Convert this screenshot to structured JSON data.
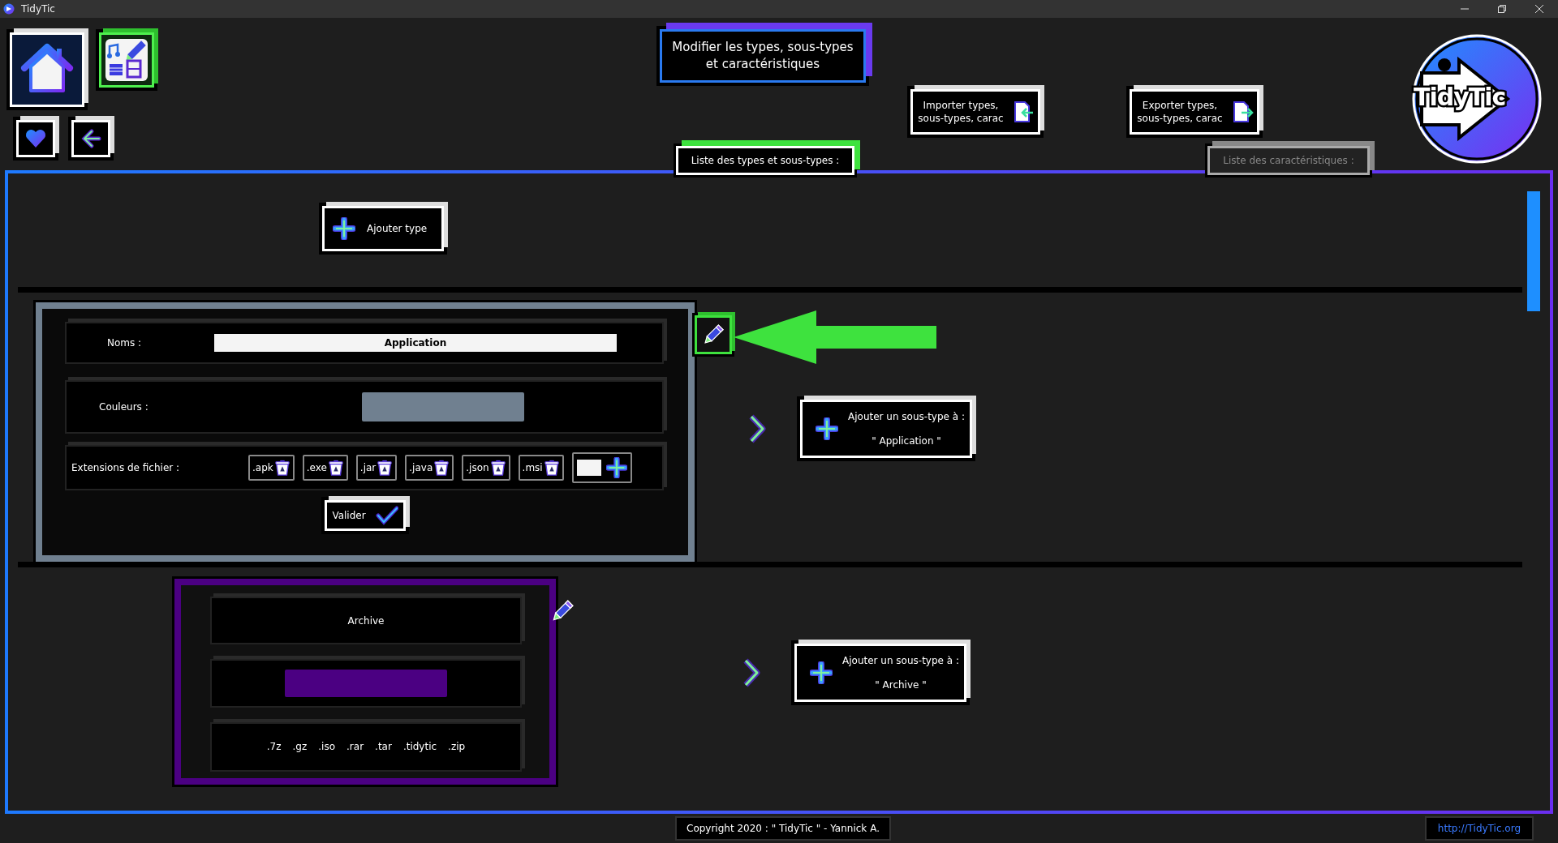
{
  "window": {
    "title": "TidyTic"
  },
  "header": {
    "title": "Modifier les types, sous-types et caractéristiques",
    "import_button": "Importer types, sous-types, carac",
    "export_button": "Exporter types, sous-types, carac",
    "logo_text": "TidyTic"
  },
  "tabs": [
    {
      "label": "Liste des types et sous-types :",
      "selected": true
    },
    {
      "label": "Liste des caractéristiques :",
      "selected": false
    }
  ],
  "add_type_button": "Ajouter type",
  "types": [
    {
      "kind": "editing",
      "name_label": "Noms :",
      "name": "Application",
      "color_label": "Couleurs :",
      "color": "#708090",
      "extensions_label": "Extensions de fichier :",
      "extensions": [
        ".apk",
        ".exe",
        ".jar",
        ".java",
        ".json",
        ".msi"
      ],
      "validate_button": "Valider",
      "add_subtype_label": "Ajouter un sous-type à :",
      "add_subtype_target": "\" Application \""
    },
    {
      "kind": "display",
      "name": "Archive",
      "color": "#4b0082",
      "extensions": [
        ".7z",
        ".gz",
        ".iso",
        ".rar",
        ".tar",
        ".tidytic",
        ".zip"
      ],
      "add_subtype_label": "Ajouter un sous-type à :",
      "add_subtype_target": "\" Archive \""
    }
  ],
  "footer": {
    "copyright": "Copyright 2020 : \" TidyTic \" - Yannick A.",
    "link": "http://TidyTic.org"
  }
}
